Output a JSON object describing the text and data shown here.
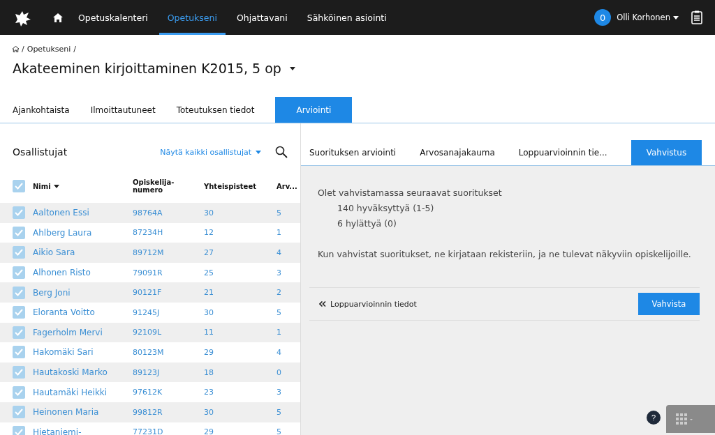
{
  "nav": {
    "items": [
      {
        "label": "Opetuskalenteri",
        "selected": false
      },
      {
        "label": "Opetukseni",
        "selected": true
      },
      {
        "label": "Ohjattavani",
        "selected": false
      },
      {
        "label": "Sähköinen asiointi",
        "selected": false
      }
    ],
    "badge": "0",
    "user": "Olli Korhonen"
  },
  "breadcrumb": {
    "separator": "/",
    "items": [
      "Opetukseni"
    ]
  },
  "title": "Akateeminen kirjoittaminen K2015, 5 op",
  "tabs": [
    {
      "label": "Ajankohtaista",
      "selected": false
    },
    {
      "label": "Ilmoittautuneet",
      "selected": false
    },
    {
      "label": "Toteutuksen tiedot",
      "selected": false
    },
    {
      "label": "Arviointi",
      "selected": true
    }
  ],
  "participants": {
    "heading": "Osallistujat",
    "filter": "Näytä kaikki osallistujat",
    "all_checked": true,
    "columns": [
      "Nimi",
      "Opiskelija-numero",
      "Yhteispisteet",
      "Arv..."
    ],
    "rows": [
      {
        "name": "Aaltonen Essi",
        "number": "98764A",
        "points": "30",
        "grade": "5",
        "checked": true
      },
      {
        "name": "Ahlberg Laura",
        "number": "87234H",
        "points": "12",
        "grade": "1",
        "checked": true
      },
      {
        "name": "Aikio Sara",
        "number": "89712M",
        "points": "27",
        "grade": "4",
        "checked": true
      },
      {
        "name": "Alhonen Risto",
        "number": "79091R",
        "points": "25",
        "grade": "3",
        "checked": true
      },
      {
        "name": "Berg Joni",
        "number": "90121F",
        "points": "21",
        "grade": "2",
        "checked": true
      },
      {
        "name": "Eloranta Voitto",
        "number": "91245J",
        "points": "30",
        "grade": "5",
        "checked": true
      },
      {
        "name": "Fagerholm Mervi",
        "number": "92109L",
        "points": "11",
        "grade": "1",
        "checked": true
      },
      {
        "name": "Hakomäki Sari",
        "number": "80123M",
        "points": "29",
        "grade": "4",
        "checked": true
      },
      {
        "name": "Hautakoski Marko",
        "number": "89123J",
        "points": "18",
        "grade": "0",
        "checked": true
      },
      {
        "name": "Hautamäki Heikki",
        "number": "97612K",
        "points": "23",
        "grade": "3",
        "checked": true
      },
      {
        "name": "Heinonen Maria",
        "number": "99812R",
        "points": "30",
        "grade": "5",
        "checked": true
      },
      {
        "name": "Hietaniemi-",
        "number": "77231D",
        "points": "29",
        "grade": "5",
        "checked": true
      }
    ]
  },
  "subtabs": [
    {
      "label": "Suorituksen arviointi",
      "selected": false
    },
    {
      "label": "Arvosanajakauma",
      "selected": false
    },
    {
      "label": "Loppuarvioinnin tie...",
      "selected": false
    },
    {
      "label": "Vahvistus",
      "selected": true
    }
  ],
  "confirmation": {
    "intro": "Olet vahvistamassa seuraavat suoritukset",
    "items": [
      "140 hyväksyttyä (1-5)",
      "6 hylättyä (0)"
    ],
    "note": "Kun vahvistat suoritukset, ne kirjataan rekisteriin, ja ne tulevat näkyviin opiskelijoille.",
    "back": "Loppuarvioinnin tiedot",
    "confirm": "Vahvista"
  },
  "help": "?"
}
